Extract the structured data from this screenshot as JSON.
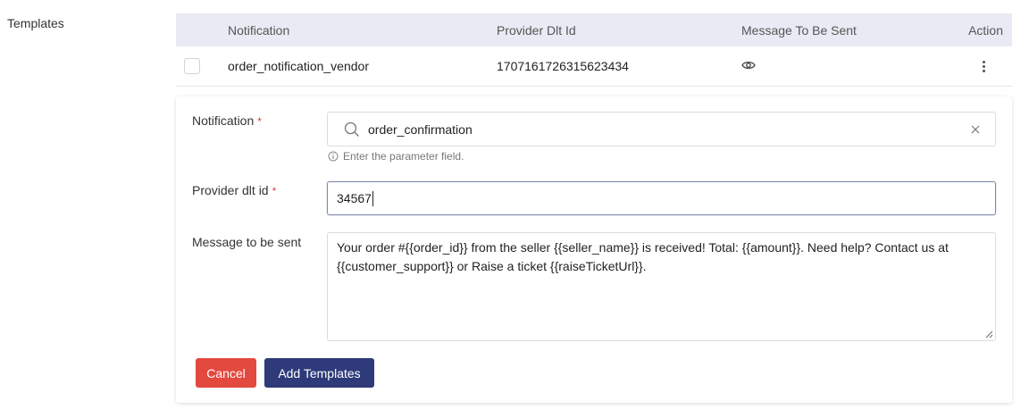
{
  "section": {
    "label": "Templates"
  },
  "table": {
    "columns": [
      "Notification",
      "Provider Dlt Id",
      "Message To Be Sent",
      "Action"
    ],
    "rows": [
      {
        "notification": "order_notification_vendor",
        "provider_dlt_id": "1707161726315623434"
      }
    ]
  },
  "form": {
    "notification": {
      "label": "Notification",
      "required_mark": "*",
      "value": "order_confirmation",
      "hint": "Enter the parameter field."
    },
    "provider_dlt_id": {
      "label": "Provider dlt id",
      "required_mark": "*",
      "value": "34567"
    },
    "message": {
      "label": "Message to be sent",
      "value": "Your order #{{order_id}} from the seller {{seller_name}} is received! Total: {{amount}}. Need help? Contact us at {{customer_support}} or Raise a ticket {{raiseTicketUrl}}."
    },
    "buttons": {
      "cancel_label": "Cancel",
      "add_label": "Add Templates"
    }
  },
  "colors": {
    "header_bg": "#e8ebf3",
    "cancel": "#e4493f",
    "primary": "#2e3a7a",
    "required": "#e0413b"
  },
  "icons": {
    "view": "eye-icon",
    "more": "kebab-icon",
    "search": "search-icon",
    "clear": "close-icon",
    "info": "info-icon",
    "resize": "resize-handle-icon"
  }
}
